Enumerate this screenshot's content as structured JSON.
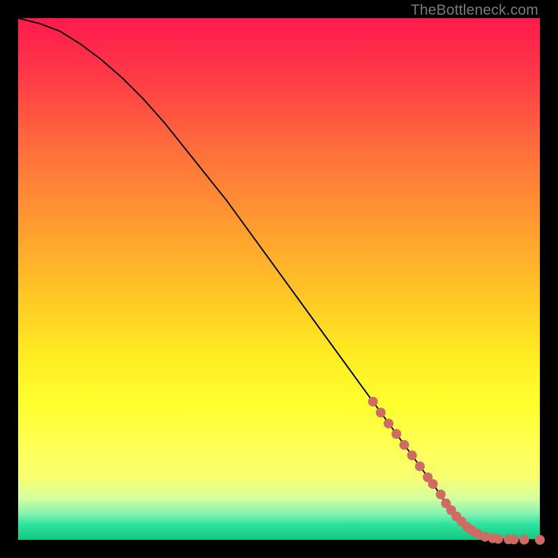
{
  "watermark": "TheBottleneck.com",
  "colors": {
    "background": "#000000",
    "curve": "#000000",
    "marker": "#cf6b63",
    "gradient_top": "#ff1a4d",
    "gradient_bottom": "#12c97f"
  },
  "chart_data": {
    "type": "line",
    "title": "",
    "xlabel": "",
    "ylabel": "",
    "xlim": [
      0,
      100
    ],
    "ylim": [
      0,
      100
    ],
    "grid": false,
    "legend": false,
    "series": [
      {
        "name": "curve",
        "x": [
          0,
          4,
          8,
          12,
          16,
          20,
          24,
          28,
          32,
          36,
          40,
          44,
          48,
          52,
          56,
          60,
          64,
          68,
          72,
          76,
          80,
          82,
          84,
          86,
          88,
          90,
          92,
          94,
          96,
          98,
          100
        ],
        "y": [
          100,
          99,
          97.5,
          95,
          92,
          88.5,
          84.5,
          80,
          75,
          70,
          65,
          59.5,
          54,
          48.5,
          43,
          37.5,
          32,
          26.5,
          21,
          15.5,
          10,
          7,
          4.5,
          2.5,
          1.2,
          0.5,
          0.2,
          0.1,
          0.05,
          0.02,
          0
        ]
      }
    ],
    "markers": [
      {
        "x": 68,
        "y": 26.5
      },
      {
        "x": 69.5,
        "y": 24.4
      },
      {
        "x": 71,
        "y": 22.3
      },
      {
        "x": 72.5,
        "y": 20.3
      },
      {
        "x": 74,
        "y": 18.2
      },
      {
        "x": 75.5,
        "y": 16.2
      },
      {
        "x": 77,
        "y": 14.1
      },
      {
        "x": 78.5,
        "y": 12
      },
      {
        "x": 79.5,
        "y": 10.7
      },
      {
        "x": 81,
        "y": 8.7
      },
      {
        "x": 82,
        "y": 7
      },
      {
        "x": 83,
        "y": 5.7
      },
      {
        "x": 84,
        "y": 4.5
      },
      {
        "x": 85,
        "y": 3.5
      },
      {
        "x": 86,
        "y": 2.5
      },
      {
        "x": 87,
        "y": 1.8
      },
      {
        "x": 88,
        "y": 1.2
      },
      {
        "x": 89.5,
        "y": 0.6
      },
      {
        "x": 91,
        "y": 0.3
      },
      {
        "x": 92,
        "y": 0.2
      },
      {
        "x": 94,
        "y": 0.1
      },
      {
        "x": 95,
        "y": 0.08
      },
      {
        "x": 97,
        "y": 0.04
      },
      {
        "x": 100,
        "y": 0
      }
    ],
    "marker_radius_px": 7
  }
}
